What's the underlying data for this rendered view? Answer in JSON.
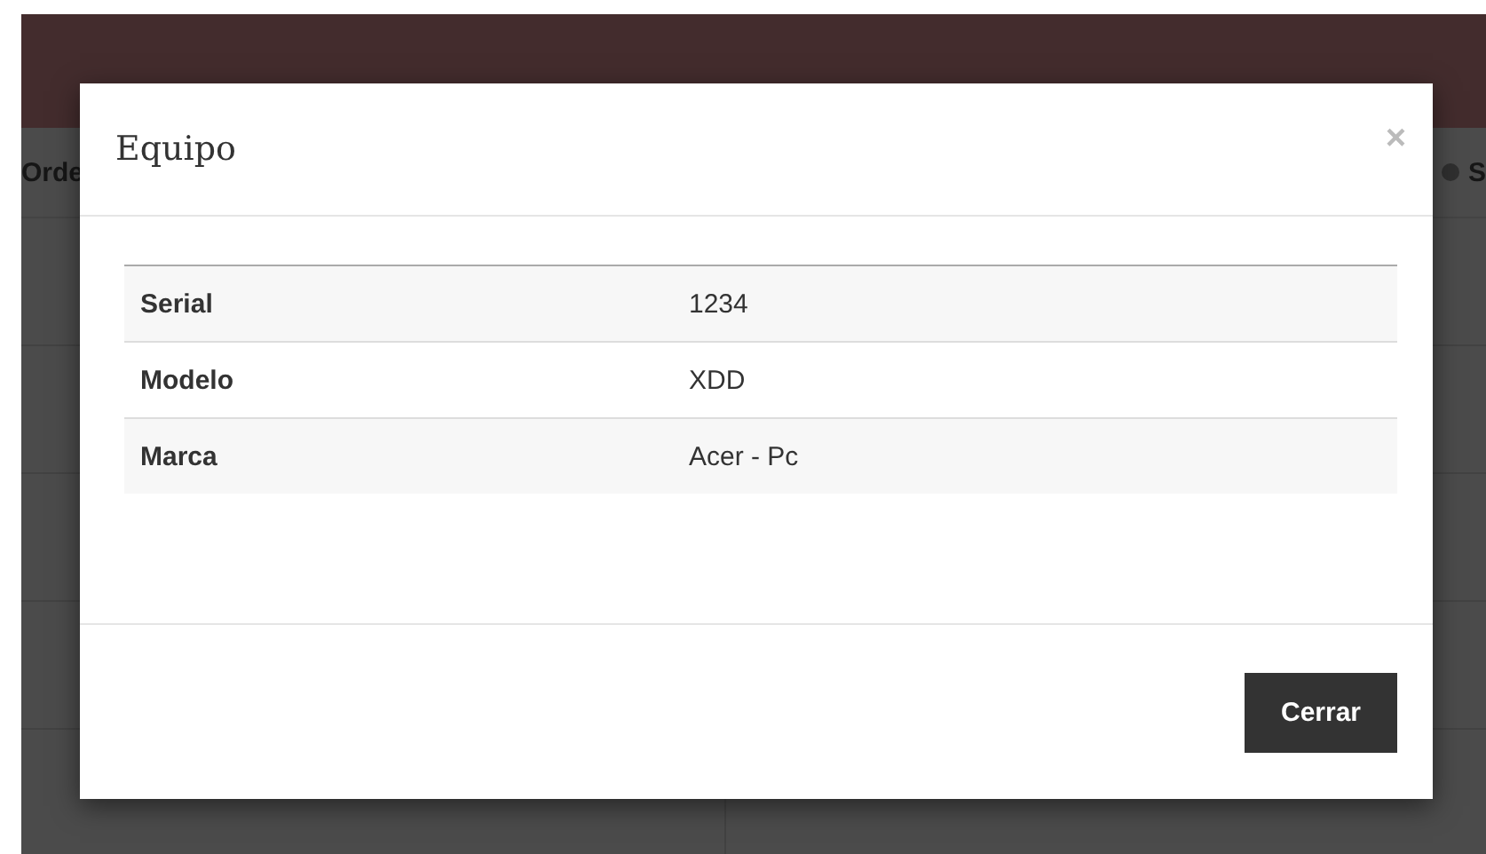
{
  "background": {
    "left_text": "Orde",
    "right_text": "S"
  },
  "modal": {
    "title": "Equipo",
    "close": "×",
    "rows": [
      {
        "label": "Serial",
        "value": "1234"
      },
      {
        "label": "Modelo",
        "value": "XDD"
      },
      {
        "label": "Marca",
        "value": "Acer - Pc"
      }
    ],
    "buttons": [
      "Cerrar"
    ]
  }
}
